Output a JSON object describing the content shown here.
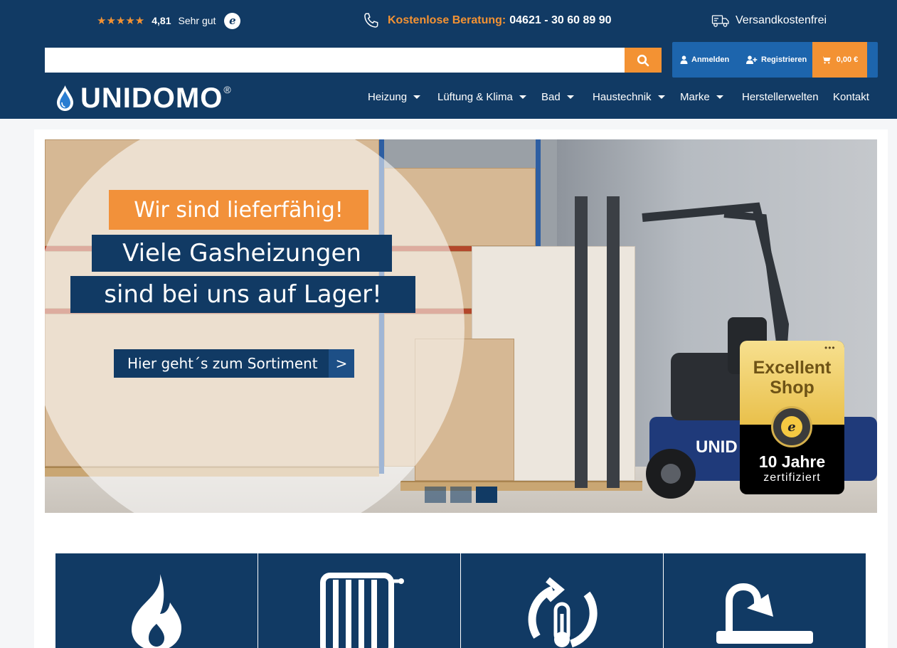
{
  "topbar": {
    "rating": {
      "stars": "★★★★★",
      "score": "4,81",
      "label": "Sehr gut",
      "badge": "e"
    },
    "phone": {
      "label": "Kostenlose Beratung:",
      "number": "04621 - 30 60 89 90"
    },
    "shipping": {
      "label": "Versandkostenfrei"
    }
  },
  "search": {
    "value": "",
    "placeholder": ""
  },
  "account": {
    "login_label": "Anmelden",
    "register_label": "Registrieren",
    "cart_total": "0,00 €"
  },
  "brand": {
    "name": "UNIDOMO",
    "registered": "®"
  },
  "nav": {
    "items": [
      {
        "label": "Heizung"
      },
      {
        "label": "Lüftung & Klima"
      },
      {
        "label": "Bad"
      },
      {
        "label": "Haustechnik"
      },
      {
        "label": "Marke"
      },
      {
        "label": "Herstellerwelten"
      },
      {
        "label": "Kontakt"
      }
    ]
  },
  "hero": {
    "headline": "Wir sind lieferfähig!",
    "line1": "Viele Gasheizungen",
    "line2": "sind bei uns auf Lager!",
    "cta_label": "Hier geht´s zum Sortiment",
    "cta_arrow": ">",
    "slide_count": 3,
    "active_slide": 3
  },
  "trust_badge": {
    "dots": "•••",
    "title": "Excellent Shop",
    "seal": "e",
    "years": "10 Jahre",
    "certified": "zertifiziert"
  },
  "categories": [
    {
      "icon": "flame-icon"
    },
    {
      "icon": "radiator-icon"
    },
    {
      "icon": "thermostat-cycle-icon"
    },
    {
      "icon": "bathtub-shower-icon"
    }
  ],
  "colors": {
    "header_bg": "#113a64",
    "accent": "#f39233",
    "account_bg": "#1d65ad",
    "tile_bg": "#113a64"
  }
}
